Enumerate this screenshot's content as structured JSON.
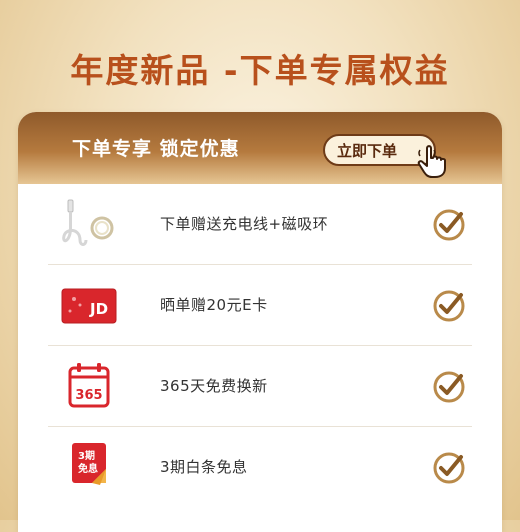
{
  "title": "年度新品 -下单专属权益",
  "header": {
    "text": "下单专享 锁定优惠",
    "button_label": "立即下单"
  },
  "benefits": [
    {
      "label": "下单赠送充电线+磁吸环",
      "icon": "cable-and-ring-icon"
    },
    {
      "label": "晒单赠20元E卡",
      "icon": "jd-gift-card-icon",
      "card_text": "JD"
    },
    {
      "label": "365天免费换新",
      "icon": "calendar-365-icon",
      "calendar_text": "365"
    },
    {
      "label": "3期白条免息",
      "icon": "installment-badge-icon",
      "badge_line1": "3期",
      "badge_line2": "免息"
    }
  ],
  "colors": {
    "title": "#b8501c",
    "header_dark": "#8f5a2b",
    "header_light": "#e6c694",
    "check": "#a9722f",
    "jd_red": "#d9262c"
  }
}
